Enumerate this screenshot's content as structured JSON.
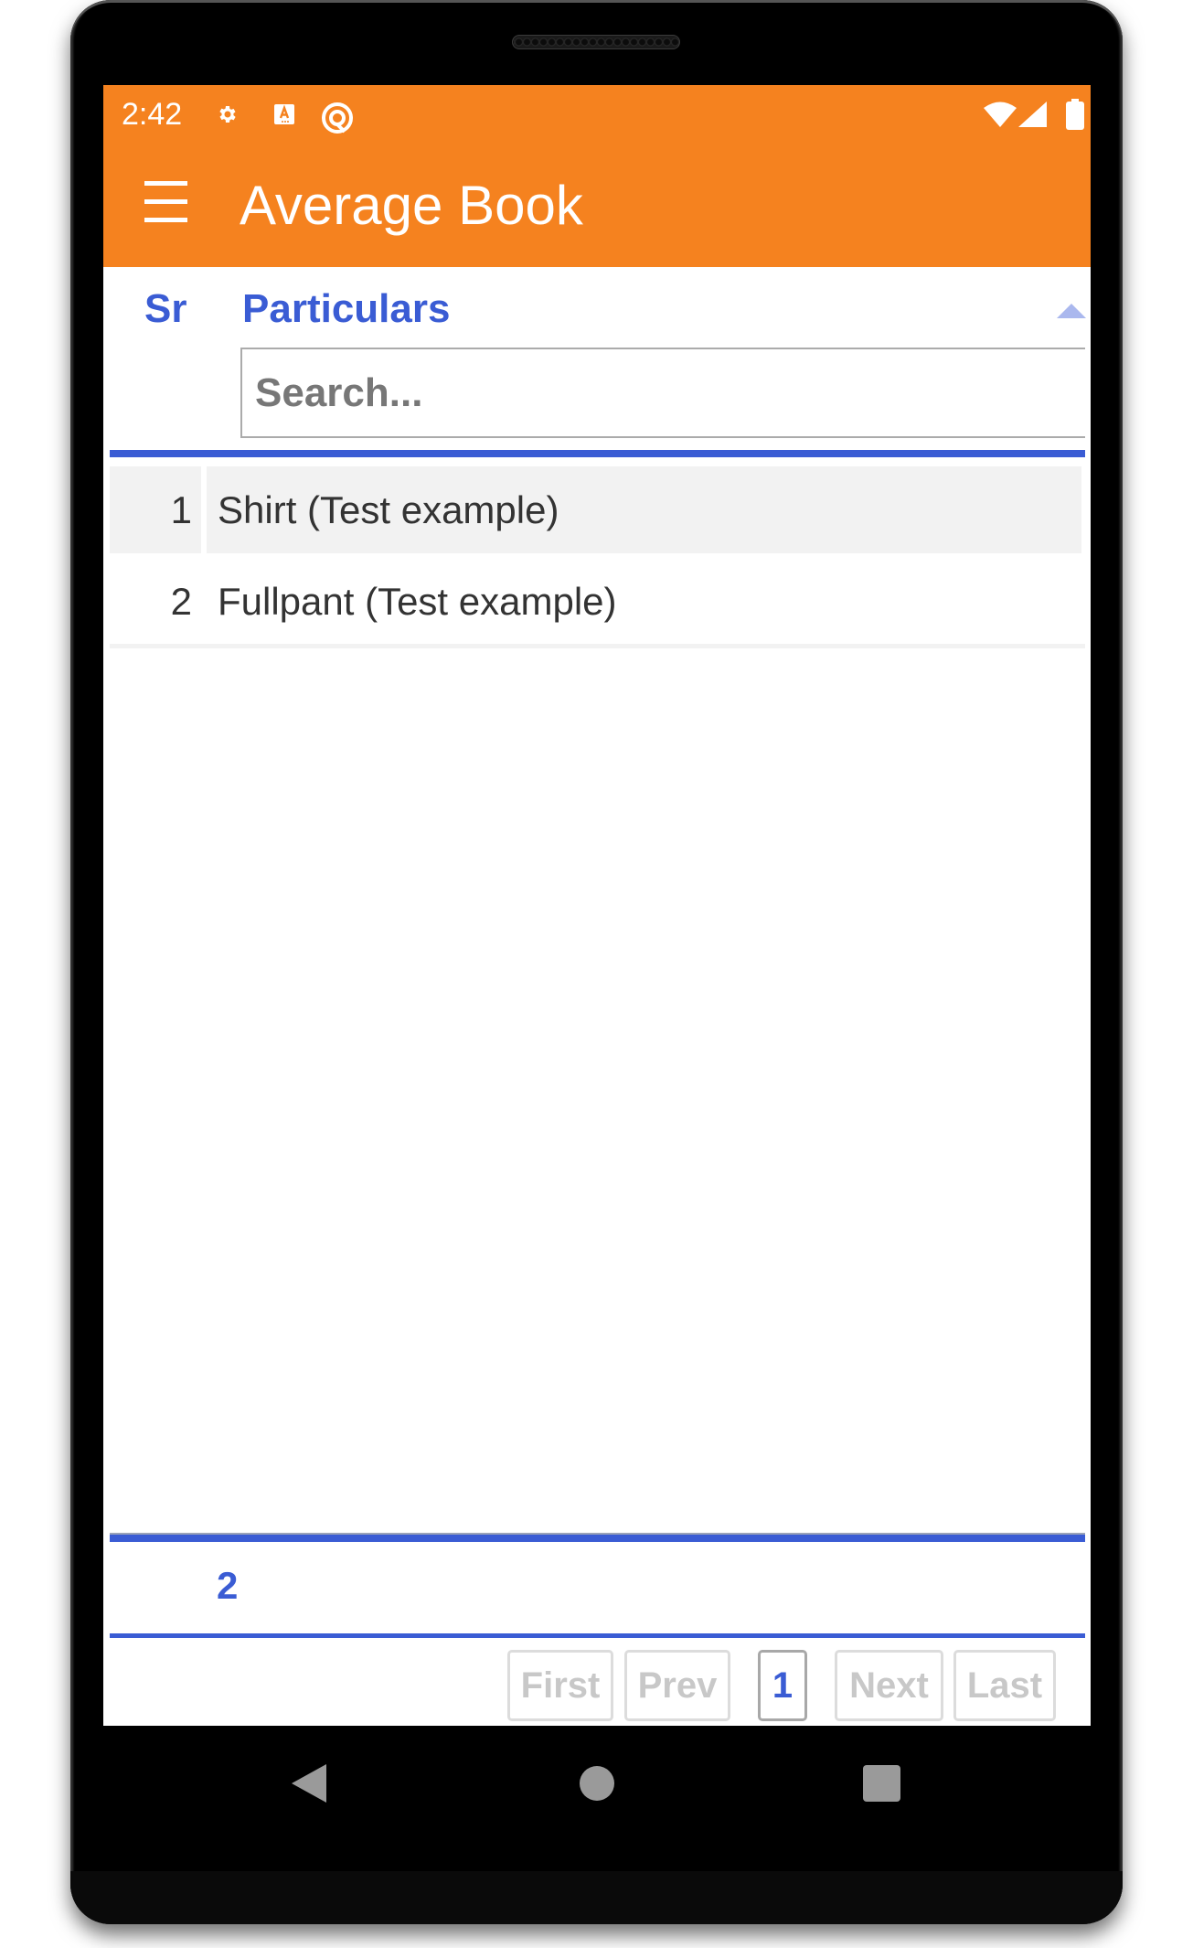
{
  "status_bar": {
    "time": "2:42",
    "icons": [
      "settings-gear-icon",
      "accessibility-a-icon",
      "q-logo-icon",
      "wifi-icon",
      "cellular-signal-icon",
      "battery-icon"
    ]
  },
  "app_bar": {
    "menu_icon": "hamburger-menu-icon",
    "title": "Average Book"
  },
  "colors": {
    "primary": "#F5821F",
    "accent": "#3A5CD4",
    "row_stripe": "#F2F2F2",
    "disabled": "#C8C8C8"
  },
  "table": {
    "columns": [
      {
        "label": "Sr"
      },
      {
        "label": "Particulars",
        "sort": "ascending"
      }
    ],
    "search": {
      "value": "",
      "placeholder": "Search..."
    },
    "rows": [
      {
        "sr": "1",
        "particulars": "Shirt (Test example)"
      },
      {
        "sr": "2",
        "particulars": "Fullpant (Test example)"
      }
    ],
    "footer": {
      "count": "2"
    }
  },
  "pagination": {
    "first": "First",
    "prev": "Prev",
    "current_page": "1",
    "next": "Next",
    "last": "Last"
  },
  "nav_bar": {
    "icons": [
      "back-icon",
      "home-icon",
      "recents-icon"
    ]
  }
}
